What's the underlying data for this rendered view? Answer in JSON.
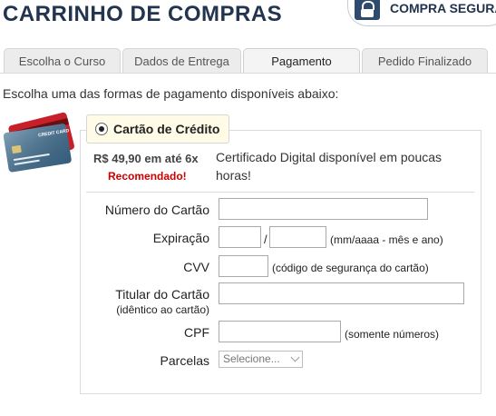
{
  "header": {
    "title": "CARRINHO DE COMPRAS",
    "secure_badge": "COMPRA SEGURA"
  },
  "tabs": [
    {
      "label": "Escolha o Curso",
      "active": false
    },
    {
      "label": "Dados de Entrega",
      "active": false
    },
    {
      "label": "Pagamento",
      "active": true
    },
    {
      "label": "Pedido Finalizado",
      "active": false
    }
  ],
  "intro": "Escolha uma das formas de pagamento disponíveis abaixo:",
  "payment": {
    "card_image_label": "CREDIT CARD",
    "option_label": "Cartão de Crédito",
    "price": "R$ 49,90 em até 6x",
    "recommended": "Recomendado!",
    "certificate_note": "Certificado Digital disponível em poucas horas!"
  },
  "form": {
    "card_number_label": "Número do Cartão",
    "card_number_value": "",
    "expiry_label": "Expiração",
    "expiry_separator": "/",
    "expiry_hint": "(mm/aaaa - mês e ano)",
    "cvv_label": "CVV",
    "cvv_hint": "(código de segurança do cartão)",
    "holder_label": "Titular do Cartão",
    "holder_sublabel": "(idêntico ao cartão)",
    "cpf_label": "CPF",
    "cpf_hint": "(somente números)",
    "installments_label": "Parcelas",
    "installments_selected": "Selecione..."
  },
  "colors": {
    "title": "#22344e",
    "recommended": "#cc0000",
    "option_bg": "#fffbe6"
  }
}
